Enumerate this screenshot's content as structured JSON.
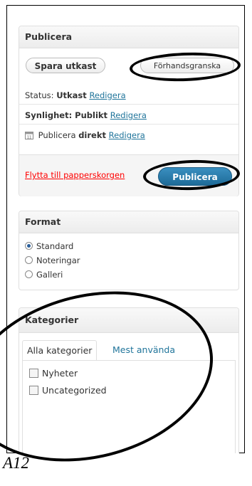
{
  "publish": {
    "title": "Publicera",
    "save_draft": "Spara utkast",
    "preview": "Förhandsgranska",
    "status_label": "Status: ",
    "status_value": "Utkast",
    "edit": "Redigera",
    "visibility_label": "Synlighet: ",
    "visibility_value": "Publikt",
    "schedule_label": "Publicera ",
    "schedule_value": "direkt",
    "trash": "Flytta till papperskorgen",
    "publish_button": "Publicera"
  },
  "format": {
    "title": "Format",
    "options": [
      "Standard",
      "Noteringar",
      "Galleri"
    ],
    "selected": "Standard"
  },
  "categories": {
    "title": "Kategorier",
    "tabs": [
      "Alla kategorier",
      "Mest använda"
    ],
    "items": [
      "Nyheter",
      "Uncategorized"
    ]
  },
  "caption": "A12",
  "colors": {
    "link": "#21759b",
    "trash": "#ff0000",
    "primary_button": "#21759b"
  }
}
